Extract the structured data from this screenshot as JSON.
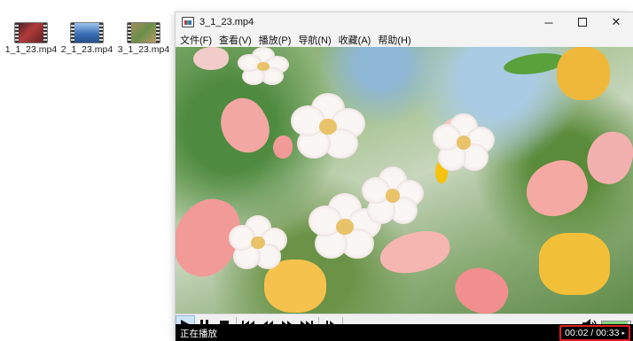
{
  "desktop": {
    "files": [
      {
        "name": "1_1_23.mp4",
        "thumb": "video-thumbnail-red-flowers"
      },
      {
        "name": "2_1_23.mp4",
        "thumb": "video-thumbnail-blue-sky"
      },
      {
        "name": "3_1_23.mp4",
        "thumb": "video-thumbnail-green-garden"
      }
    ]
  },
  "window": {
    "title": "3_1_23.mp4",
    "icon": "film-clapper-icon",
    "controls": {
      "minimize": "─",
      "maximize": "☐",
      "close": "✕"
    }
  },
  "menu": {
    "items": [
      "文件(F)",
      "查看(V)",
      "播放(P)",
      "导航(N)",
      "收藏(A)",
      "帮助(H)"
    ]
  },
  "playback_controls": {
    "icons": [
      "play-icon",
      "pause-icon",
      "stop-icon",
      "skip-back-icon",
      "rewind-icon",
      "fast-forward-icon",
      "skip-forward-icon",
      "frame-step-icon"
    ],
    "volume_fraction": 0.9
  },
  "status": {
    "text": "正在播放",
    "time_current": "00:02",
    "time_total": "00:33",
    "time_separator": " / ",
    "time_display": "00:02 / 00:33"
  },
  "colors": {
    "highlight": "#e01e1e",
    "status_bg": "#000000",
    "volume_green": "#3cb83a"
  }
}
